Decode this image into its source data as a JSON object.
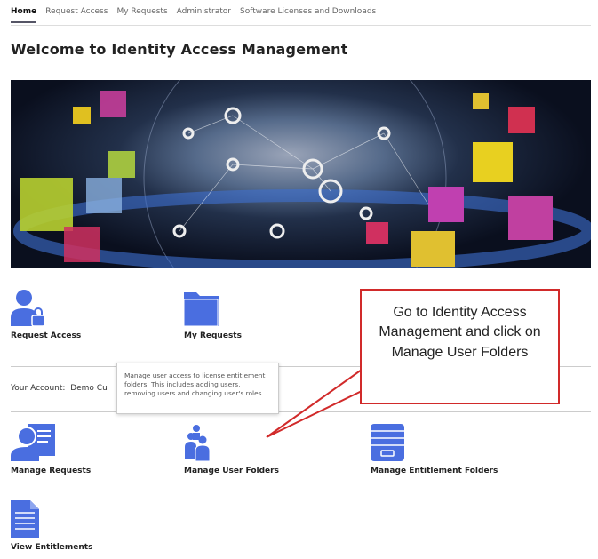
{
  "nav": {
    "items": [
      "Home",
      "Request Access",
      "My Requests",
      "Administrator",
      "Software Licenses and Downloads"
    ],
    "active": "Home"
  },
  "page_title": "Welcome to Identity Access Management",
  "tiles": {
    "request_access": "Request Access",
    "my_requests": "My Requests",
    "manage_requests": "Manage Requests",
    "manage_user_folders": "Manage User Folders",
    "manage_entitlement_folders": "Manage Entitlement Folders",
    "view_entitlements": "View Entitlements"
  },
  "account": {
    "label": "Your Account:",
    "value": "Demo Cu"
  },
  "tooltip": "Manage user access to license entitlement folders. This includes adding users, removing users and changing user's roles.",
  "callout": "Go to Identity Access Management and click on Manage User Folders",
  "colors": {
    "icon": "#4a6ee0",
    "callout_border": "#d12a2a"
  }
}
